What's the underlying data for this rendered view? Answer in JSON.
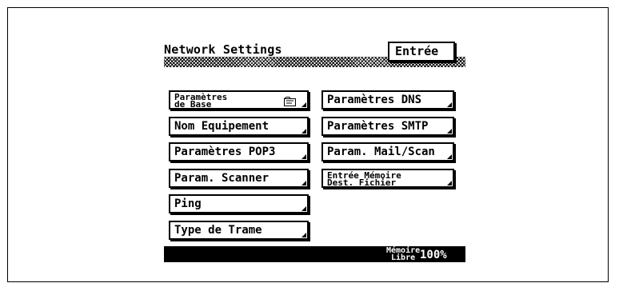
{
  "screen": {
    "title": "Network Settings",
    "enter_label": "Entrée"
  },
  "menu": {
    "left": [
      {
        "line1": "Paramètres",
        "line2": "de Base"
      },
      {
        "label": "Nom Equipement"
      },
      {
        "label": "Paramètres POP3"
      },
      {
        "label": "Param. Scanner"
      },
      {
        "label": "Ping"
      },
      {
        "label": "Type de Trame"
      }
    ],
    "right": [
      {
        "label": "Paramètres DNS"
      },
      {
        "label": "Paramètres SMTP"
      },
      {
        "label": "Param. Mail/Scan"
      },
      {
        "line1": "Entrée Mémoire",
        "line2": "Dest. Fichier"
      }
    ]
  },
  "status": {
    "memory_line1": "Mémoire",
    "memory_line2": "Libre",
    "memory_value": "100%"
  },
  "icons": {
    "basic_settings": "folder-icon"
  }
}
